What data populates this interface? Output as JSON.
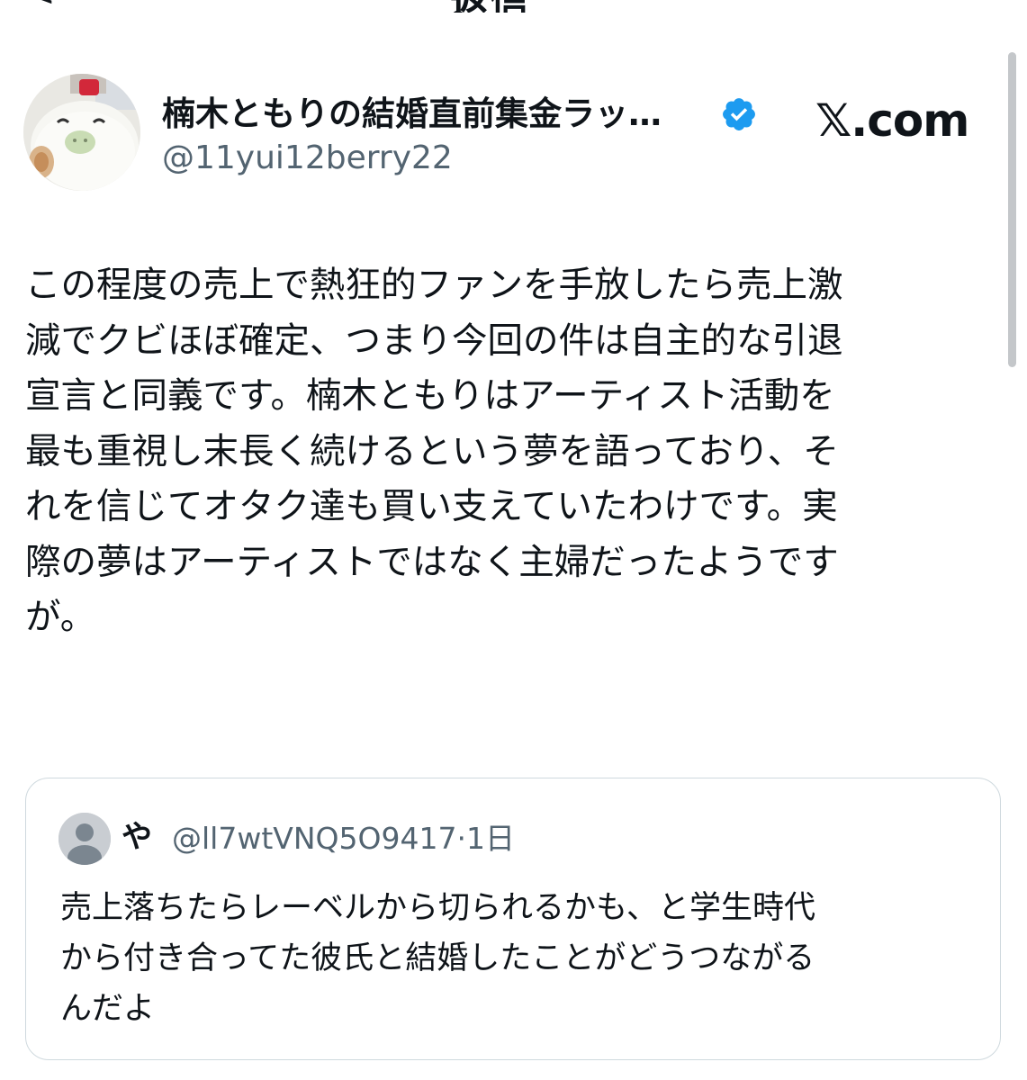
{
  "header": {
    "title": "返信",
    "back_glyph": "<"
  },
  "tweet": {
    "author_name": "楠木ともりの結婚直前集金ラッ…",
    "author_handle": "@11yui12berry22",
    "verified": true,
    "site_label": "𝕏.com",
    "body": "この程度の売上で熱狂的ファンを手放したら売上激\n減でクビほぼ確定、つまり今回の件は自主的な引退\n宣言と同義です。楠木ともりはアーティスト活動を\n最も重視し末長く続けるという夢を語っており、そ\nれを信じてオタク達も買い支えていたわけです。実\n際の夢はアーティストではなく主婦だったようです\nが。"
  },
  "quote": {
    "author_name": "や",
    "author_handle": "@ll7wtVNQ5O9417",
    "separator": "·",
    "time": "1日",
    "body": "売上落ちたらレーベルから切られるかも、と学生時代\nから付き合ってた彼氏と結婚したことがどうつながる\nんだよ"
  },
  "colors": {
    "text": "#0f1419",
    "secondary": "#536471",
    "verified_badge": "#1d9bf0",
    "border": "#cfd9de"
  },
  "icons": {
    "verified": "verified-badge-icon",
    "default_avatar": "default-avatar-icon"
  }
}
